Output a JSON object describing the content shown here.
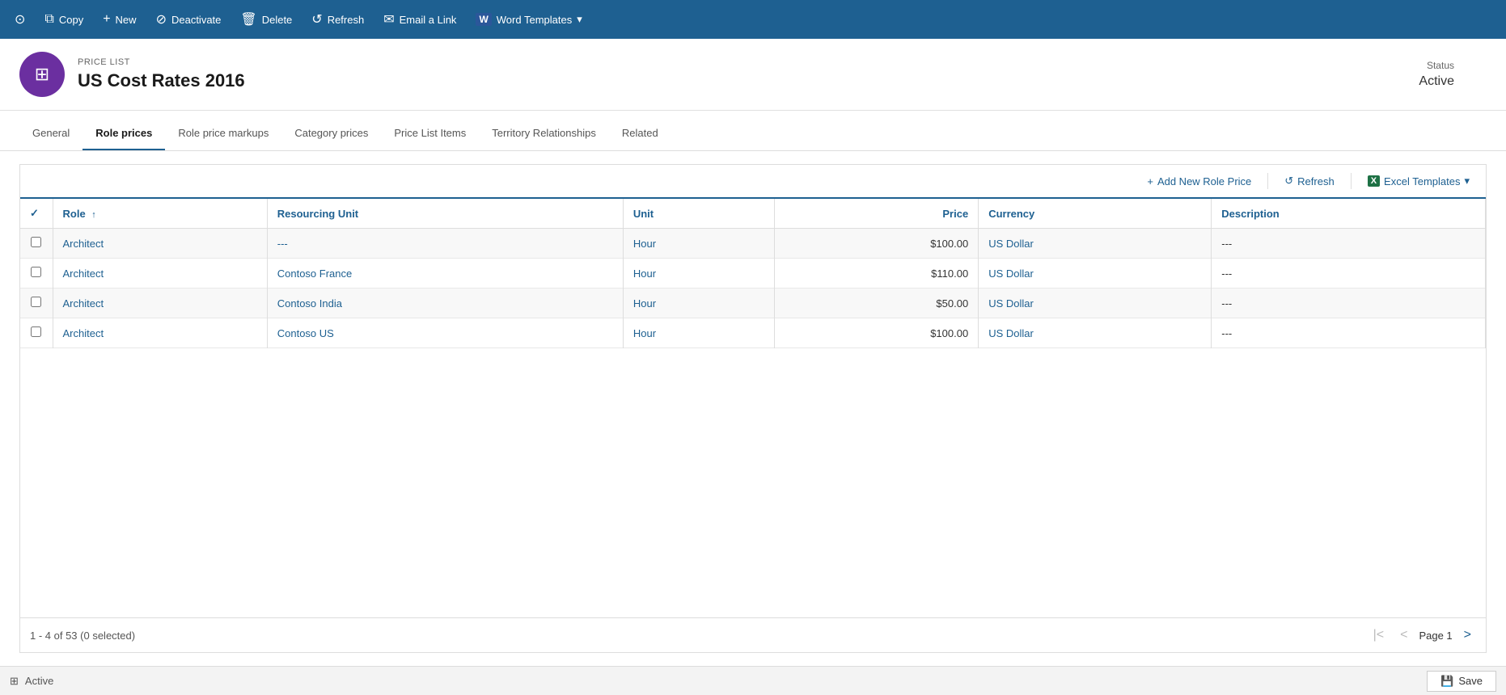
{
  "toolbar": {
    "buttons": [
      {
        "id": "copy",
        "label": "Copy",
        "icon": "⧉"
      },
      {
        "id": "new",
        "label": "New",
        "icon": "+"
      },
      {
        "id": "deactivate",
        "label": "Deactivate",
        "icon": "⊘"
      },
      {
        "id": "delete",
        "label": "Delete",
        "icon": "🗑"
      },
      {
        "id": "refresh",
        "label": "Refresh",
        "icon": "↺"
      },
      {
        "id": "email-link",
        "label": "Email a Link",
        "icon": "✉"
      },
      {
        "id": "word-templates",
        "label": "Word Templates",
        "icon": "W",
        "hasDropdown": true
      }
    ]
  },
  "record": {
    "type": "PRICE LIST",
    "title": "US Cost Rates 2016",
    "status_label": "Status",
    "status_value": "Active"
  },
  "tabs": [
    {
      "id": "general",
      "label": "General",
      "active": false
    },
    {
      "id": "role-prices",
      "label": "Role prices",
      "active": true
    },
    {
      "id": "role-price-markups",
      "label": "Role price markups",
      "active": false
    },
    {
      "id": "category-prices",
      "label": "Category prices",
      "active": false
    },
    {
      "id": "price-list-items",
      "label": "Price List Items",
      "active": false
    },
    {
      "id": "territory-relationships",
      "label": "Territory Relationships",
      "active": false
    },
    {
      "id": "related",
      "label": "Related",
      "active": false
    }
  ],
  "grid": {
    "add_button_label": "Add New Role Price",
    "refresh_label": "Refresh",
    "excel_templates_label": "Excel Templates",
    "columns": [
      {
        "id": "role",
        "label": "Role",
        "sortable": true
      },
      {
        "id": "resourcing-unit",
        "label": "Resourcing Unit"
      },
      {
        "id": "unit",
        "label": "Unit"
      },
      {
        "id": "price",
        "label": "Price",
        "align": "right"
      },
      {
        "id": "currency",
        "label": "Currency"
      },
      {
        "id": "description",
        "label": "Description"
      }
    ],
    "rows": [
      {
        "role": "Architect",
        "resourcing_unit": "---",
        "unit": "Hour",
        "price": "$100.00",
        "currency": "US Dollar",
        "description": "---"
      },
      {
        "role": "Architect",
        "resourcing_unit": "Contoso France",
        "unit": "Hour",
        "price": "$110.00",
        "currency": "US Dollar",
        "description": "---"
      },
      {
        "role": "Architect",
        "resourcing_unit": "Contoso India",
        "unit": "Hour",
        "price": "$50.00",
        "currency": "US Dollar",
        "description": "---"
      },
      {
        "role": "Architect",
        "resourcing_unit": "Contoso US",
        "unit": "Hour",
        "price": "$100.00",
        "currency": "US Dollar",
        "description": "---"
      }
    ],
    "pagination": {
      "summary": "1 - 4 of 53 (0 selected)",
      "page_label": "Page 1"
    }
  },
  "status_bar": {
    "status": "Active",
    "save_label": "Save"
  }
}
